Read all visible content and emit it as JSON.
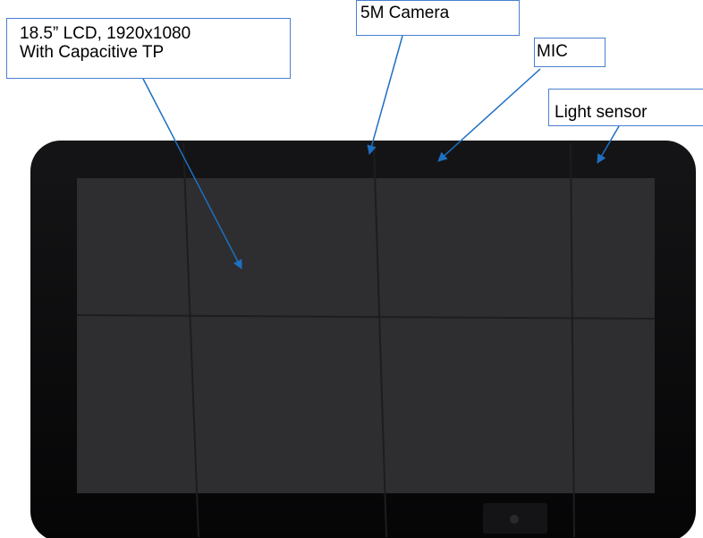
{
  "callouts": {
    "lcd": {
      "line1": "18.5” LCD, 1920x1080",
      "line2": "With Capacitive TP"
    },
    "camera": {
      "label": "5M Camera"
    },
    "mic": {
      "label": "MIC"
    },
    "light_sensor": {
      "label": "Light sensor"
    }
  },
  "colors": {
    "bezel": "#0b0b0d",
    "screen": "#2e2e30",
    "callout_border": "#4a7fd0",
    "arrow": "#1f6fc2"
  }
}
